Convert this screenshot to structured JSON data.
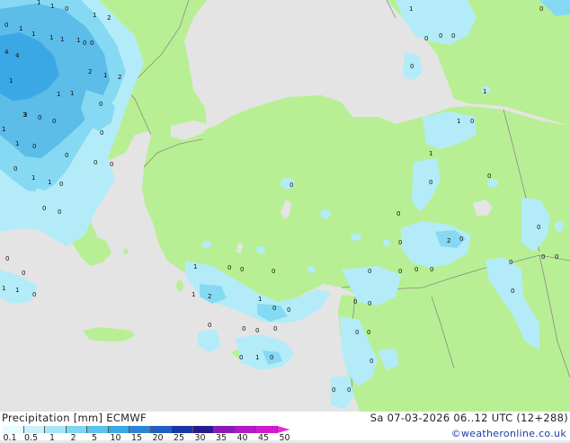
{
  "footer": {
    "title": "Precipitation [mm]  ECMWF",
    "datetime": "Sa 07-03-2026 06..12 UTC (12+288)",
    "credit": "©weatheronline.co.uk"
  },
  "legend": {
    "ticks": [
      "0.1",
      "0.5",
      "1",
      "2",
      "5",
      "10",
      "15",
      "20",
      "25",
      "30",
      "35",
      "40",
      "45",
      "50"
    ],
    "colors": [
      "#e8fbff",
      "#c8f2fb",
      "#a4e6f7",
      "#7ed6f2",
      "#58c3ec",
      "#3aa8e4",
      "#2a85d6",
      "#1f5fc4",
      "#1838a8",
      "#2a1a90",
      "#8a1ab8",
      "#b21ac4",
      "#d21ad0",
      "#e82ad8"
    ]
  },
  "map": {
    "colors": {
      "land": "#b8ef94",
      "sea": "#e4e4e4",
      "unmodeled": "#e8e8e8",
      "border": "#8a8a8a",
      "precip_light": "#b3ecf8",
      "precip_mid": "#86d9f2",
      "precip_heavy": "#5bbde8"
    },
    "labels": [
      "1",
      "1",
      "0",
      "1",
      "2",
      "0",
      "1",
      "4",
      "4",
      "1",
      "1",
      "1",
      "1",
      "0",
      "2",
      "1",
      "2",
      "3",
      "1",
      "0",
      "1",
      "1",
      "0",
      "3",
      "0",
      "1",
      "1",
      "0",
      "0",
      "0",
      "0",
      "0",
      "0",
      "1",
      "1",
      "0",
      "0",
      "0",
      "0",
      "1",
      "1",
      "1",
      "0",
      "0",
      "0",
      "0",
      "0",
      "0",
      "0",
      "0",
      "0",
      "0",
      "0",
      "0",
      "0",
      "0",
      "0",
      "0",
      "0",
      "1",
      "2",
      "0",
      "0",
      "1",
      "1",
      "2",
      "0",
      "0",
      "0",
      "0",
      "0",
      "0",
      "0",
      "0",
      "0",
      "1",
      "1",
      "0",
      "0",
      "0",
      "1",
      "0",
      "0",
      "0",
      "0",
      "0",
      "0",
      "0",
      "0",
      "1",
      "0",
      "0",
      "0"
    ]
  }
}
